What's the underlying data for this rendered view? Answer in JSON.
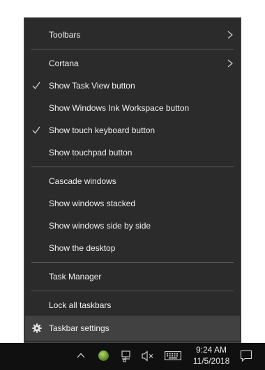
{
  "menu": {
    "items": [
      {
        "label": "Toolbars",
        "submenu": true
      },
      {
        "label": "Cortana",
        "submenu": true
      },
      {
        "label": "Show Task View button",
        "checked": true
      },
      {
        "label": "Show Windows Ink Workspace button",
        "checked": false
      },
      {
        "label": "Show touch keyboard button",
        "checked": true
      },
      {
        "label": "Show touchpad button",
        "checked": false
      },
      {
        "label": "Cascade windows"
      },
      {
        "label": "Show windows stacked"
      },
      {
        "label": "Show windows side by side"
      },
      {
        "label": "Show the desktop"
      },
      {
        "label": "Task Manager"
      },
      {
        "label": "Lock all taskbars"
      },
      {
        "label": "Taskbar settings",
        "icon": "gear-icon"
      }
    ]
  },
  "taskbar": {
    "tray_icons": [
      "chevron-up-icon",
      "app-status-icon",
      "network-icon",
      "volume-muted-icon",
      "touch-keyboard-icon",
      "action-center-icon"
    ],
    "time": "9:24 AM",
    "date": "11/5/2018"
  },
  "colors": {
    "menu_bg": "#2b2b2b",
    "hover_bg": "#414141",
    "separator": "#5a5a5a",
    "taskbar_bg": "#101010",
    "text": "#f2f2f2"
  }
}
